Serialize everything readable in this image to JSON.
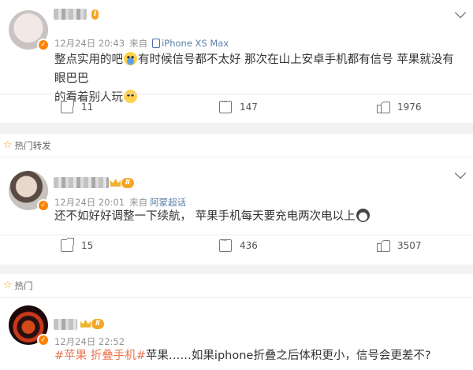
{
  "posts": [
    {
      "date": "12月24日 20:43",
      "from_label": "来自",
      "device": "iPhone XS Max",
      "content_parts": [
        "整点实用的吧",
        "有时候信号都不太好 那次在山上安卓手机都有信号 苹果就没有 眼巴巴",
        "的看着别人玩"
      ],
      "actions": {
        "share": "11",
        "comment": "147",
        "like": "1976"
      }
    },
    {
      "section_label": "热门转发",
      "date": "12月24日 20:01",
      "from_label": "来自",
      "device": "阿蒙超话",
      "content": "还不如好好调整一下续航， 苹果手机每天要充电两次电以上",
      "actions": {
        "share": "15",
        "comment": "436",
        "like": "3507"
      }
    },
    {
      "section_label": "热门",
      "date": "12月24日 22:52",
      "topic1": "#苹果 折叠手机#",
      "content": "苹果……如果iphone折叠之后体积更小，信号会更差不?"
    }
  ],
  "icons": {
    "share": "share-icon",
    "comment": "comment-icon",
    "like": "like-icon",
    "more": "chevron-down-icon",
    "verified": "verified-badge-icon",
    "star": "star-icon"
  },
  "colors": {
    "topic": "#eb7350",
    "badge": "#ff8200",
    "device": "#5d7fa8",
    "separator": "#f2f2f2"
  }
}
